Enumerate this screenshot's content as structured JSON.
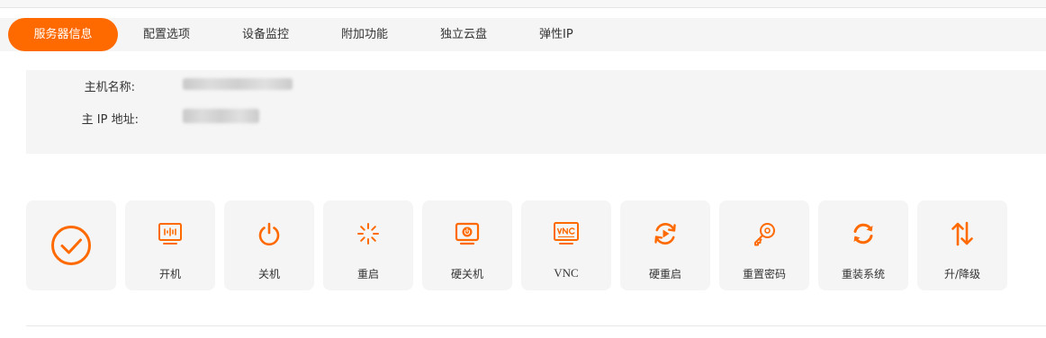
{
  "tabs": [
    {
      "label": "服务器信息",
      "active": true
    },
    {
      "label": "配置选项"
    },
    {
      "label": "设备监控"
    },
    {
      "label": "附加功能"
    },
    {
      "label": "独立云盘"
    },
    {
      "label": "弹性IP"
    }
  ],
  "info": {
    "hostname_label": "主机名称:",
    "ip_label": "主 IP 地址:"
  },
  "actions": [
    {
      "label": "开机",
      "icon": "power-on-monitor-icon"
    },
    {
      "label": "关机",
      "icon": "power-icon"
    },
    {
      "label": "重启",
      "icon": "loading-spinner-icon"
    },
    {
      "label": "硬关机",
      "icon": "monitor-power-icon"
    },
    {
      "label": "VNC",
      "icon": "vnc-monitor-icon"
    },
    {
      "label": "硬重启",
      "icon": "replay-icon"
    },
    {
      "label": "重置密码",
      "icon": "key-icon"
    },
    {
      "label": "重装系统",
      "icon": "refresh-icon"
    },
    {
      "label": "升/降级",
      "icon": "up-down-arrows-icon"
    }
  ],
  "colors": {
    "accent": "#ff6a00",
    "panel_bg": "#f5f5f5"
  }
}
